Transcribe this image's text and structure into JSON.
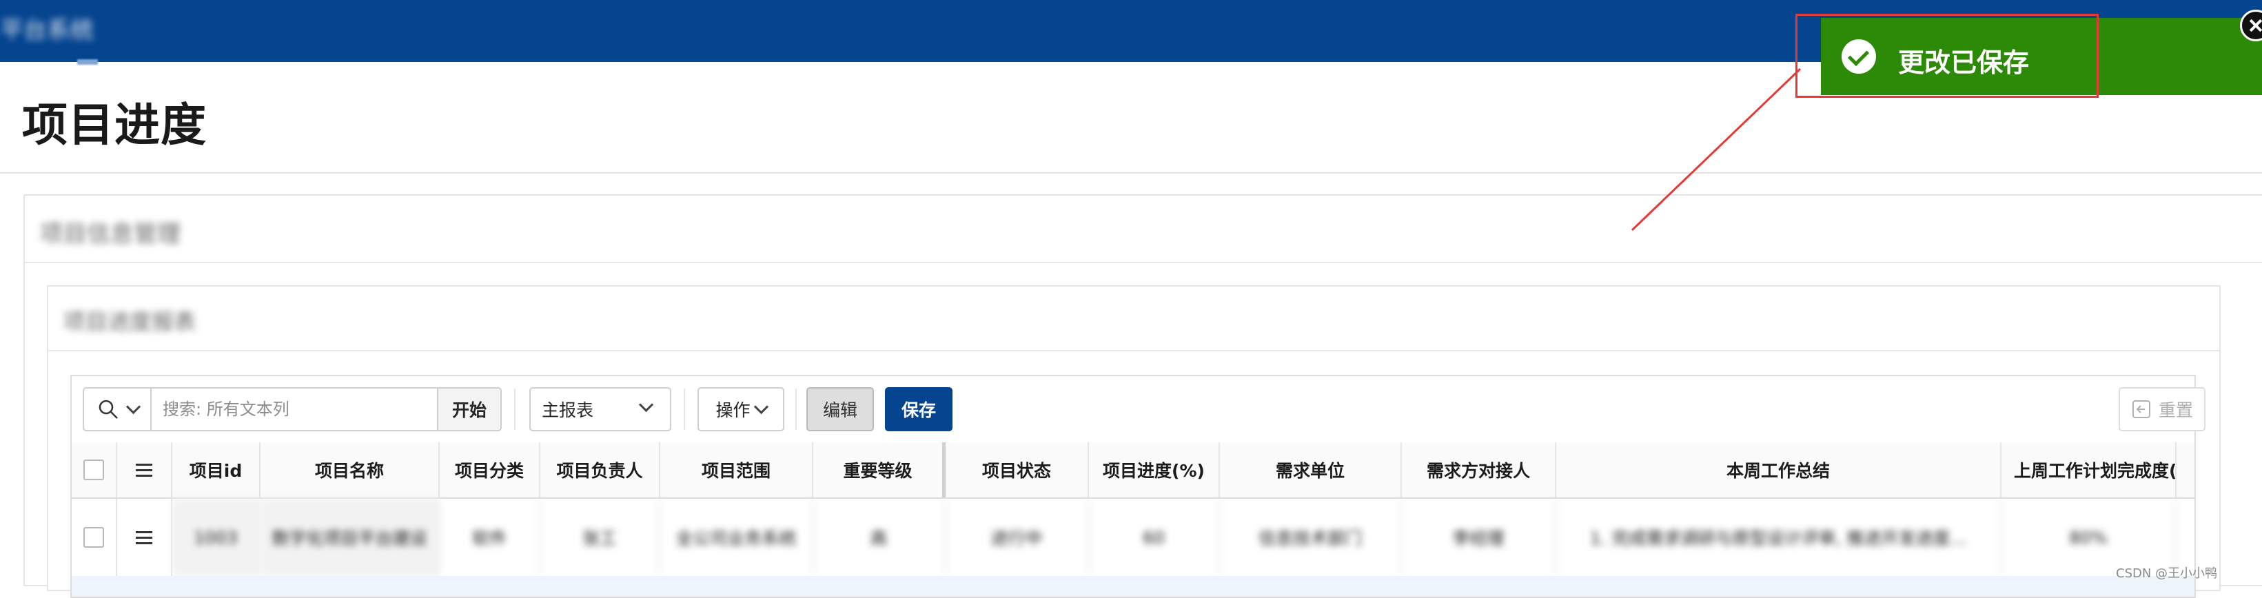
{
  "app": {
    "title": "平台系统"
  },
  "page": {
    "title": "项目进度"
  },
  "region_outer": {
    "title": "项目信息管理"
  },
  "region_inner": {
    "title": "项目进度报表"
  },
  "toolbar": {
    "search_placeholder": "搜索: 所有文本列",
    "go_label": "开始",
    "report_label": "主报表",
    "actions_label": "操作",
    "edit_label": "编辑",
    "save_label": "保存",
    "reset_label": "重置"
  },
  "table": {
    "columns": [
      "项目id",
      "项目名称",
      "项目分类",
      "项目负责人",
      "项目范围",
      "重要等级",
      "项目状态",
      "项目进度(%)",
      "需求单位",
      "需求方对接人",
      "本周工作总结",
      "上周工作计划完成度(%"
    ],
    "rows": [
      [
        "1003",
        "数字化项目平台建设",
        "软件",
        "张工",
        "全公司业务系统",
        "高",
        "进行中",
        "60",
        "信息技术部门",
        "李经理",
        "1. 完成需求调研与原型设计评审, 推进开发进度...",
        "80%"
      ]
    ]
  },
  "toast": {
    "message": "更改已保存"
  },
  "watermark": "CSDN @王小小鸭",
  "colors": {
    "brand": "#05448f",
    "success": "#2d8a07",
    "annotation": "#e53935"
  }
}
